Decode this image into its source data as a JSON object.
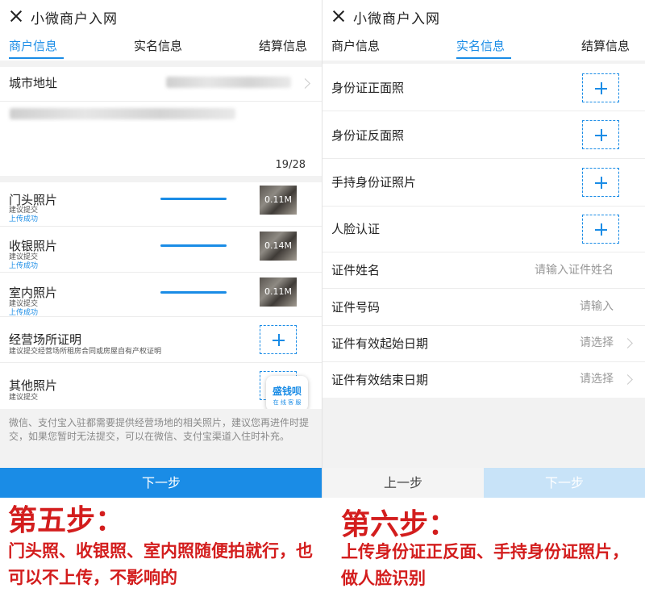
{
  "header": {
    "title": "小微商户入网"
  },
  "tabs": [
    "商户信息",
    "实名信息",
    "结算信息"
  ],
  "step5": {
    "city_label": "城市地址",
    "char_count": "19/28",
    "uploads": [
      {
        "label": "门头照片",
        "hint": "建议提交",
        "status": "上传成功",
        "size": "0.11M",
        "progress": 1.0
      },
      {
        "label": "收银照片",
        "hint": "建议提交",
        "status": "上传成功",
        "size": "0.14M",
        "progress": 1.0
      },
      {
        "label": "室内照片",
        "hint": "建议提交",
        "status": "上传成功",
        "size": "0.11M",
        "progress": 1.0
      }
    ],
    "premises": {
      "label": "经营场所证明",
      "hint": "建议提交经营场所租房合同或房屋自有产权证明"
    },
    "other": {
      "label": "其他照片",
      "hint": "建议提交"
    },
    "badge": {
      "top": "盛钱呗",
      "bottom": "在 线 客 服"
    },
    "note": "微信、支付宝入驻都需要提供经营场地的相关照片，建议您再进件时提交，如果您暂时无法提交，可以在微信、支付宝渠道入住时补充。",
    "next_button": "下一步",
    "caption_title": "第五步：",
    "caption_text": "门头照、收银照、室内照随便拍就行，也可以不上传，不影响的"
  },
  "step6": {
    "photo_rows": [
      "身份证正面照",
      "身份证反面照",
      "手持身份证照片",
      "人脸认证"
    ],
    "fields": [
      {
        "label": "证件姓名",
        "placeholder": "请输入证件姓名"
      },
      {
        "label": "证件号码",
        "placeholder": "请输入"
      },
      {
        "label": "证件有效起始日期",
        "placeholder": "请选择"
      },
      {
        "label": "证件有效结束日期",
        "placeholder": "请选择"
      }
    ],
    "prev_button": "上一步",
    "next_button": "下一步",
    "caption_title": "第六步：",
    "caption_text": "上传身份证正反面、手持身份证照片，做人脸识别"
  },
  "colors": {
    "accent": "#1a8ce6",
    "caption": "#d31d1d",
    "disabled_button": "#c8e3f8"
  }
}
